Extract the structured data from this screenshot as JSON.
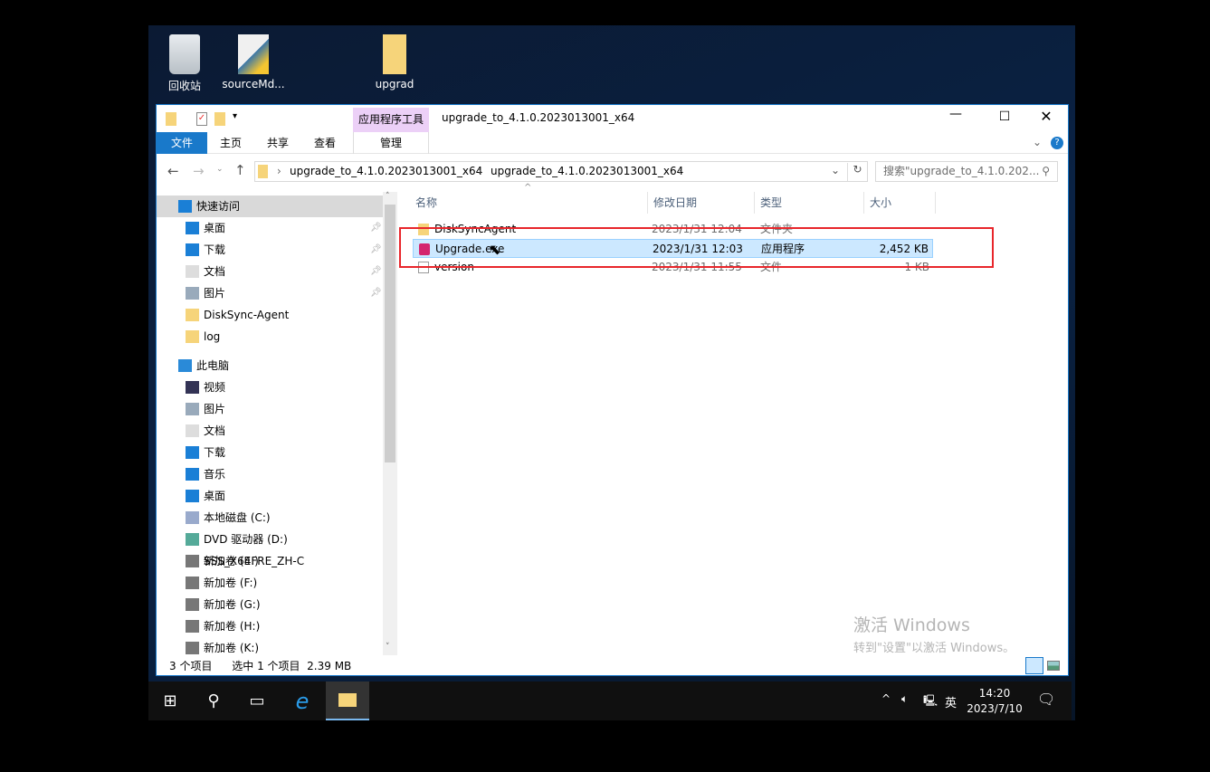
{
  "desktop": {
    "icons": [
      {
        "label": "回收站",
        "icon": "recycle-bin-icon"
      },
      {
        "label": "sourceMd...",
        "icon": "python-file-icon"
      },
      {
        "label": "upgrad",
        "icon": "folder-icon"
      }
    ]
  },
  "window": {
    "title": "upgrade_to_4.1.0.2023013001_x64",
    "context_tab_group": "应用程序工具",
    "tabs": [
      "文件",
      "主页",
      "共享",
      "查看",
      "管理"
    ],
    "breadcrumb": [
      "upgrade_to_4.1.0.2023013001_x64",
      "upgrade_to_4.1.0.2023013001_x64"
    ],
    "search_placeholder": "搜索\"upgrade_to_4.1.0.202...",
    "nav": {
      "quick_access": "快速访问",
      "quick_items": [
        "桌面",
        "下载",
        "文档",
        "图片",
        "DiskSync-Agent",
        "log"
      ],
      "this_pc": "此电脑",
      "pc_items": [
        "视频",
        "图片",
        "文档",
        "下载",
        "音乐",
        "桌面",
        "本地磁盘 (C:)",
        "DVD 驱动器 (D:) SSS_X64FRE_ZH-C",
        "新加卷 (E:)",
        "新加卷 (F:)",
        "新加卷 (G:)",
        "新加卷 (H:)",
        "新加卷 (K:)"
      ]
    },
    "columns": [
      "名称",
      "修改日期",
      "类型",
      "大小"
    ],
    "files": [
      {
        "name": "DiskSyncAgent",
        "date": "2023/1/31 12:04",
        "type": "文件夹",
        "size": "",
        "icon": "folder-icon"
      },
      {
        "name": "Upgrade.exe",
        "date": "2023/1/31 12:03",
        "type": "应用程序",
        "size": "2,452 KB",
        "icon": "exe-icon",
        "selected": true
      },
      {
        "name": "version",
        "date": "2023/1/31 11:55",
        "type": "文件",
        "size": "1 KB",
        "icon": "file-icon"
      }
    ],
    "status": {
      "count": "3 个项目",
      "selected": "选中 1 个项目  2.39 MB"
    }
  },
  "watermark": {
    "line1": "激活 Windows",
    "line2": "转到\"设置\"以激活 Windows。"
  },
  "taskbar": {
    "ime": "英",
    "time": "14:20",
    "date": "2023/7/10"
  },
  "colors": {
    "accent": "#1979ca",
    "selection": "#cce8ff",
    "highlight_box": "#e8262b",
    "context_tab": "#ecd0f7"
  }
}
